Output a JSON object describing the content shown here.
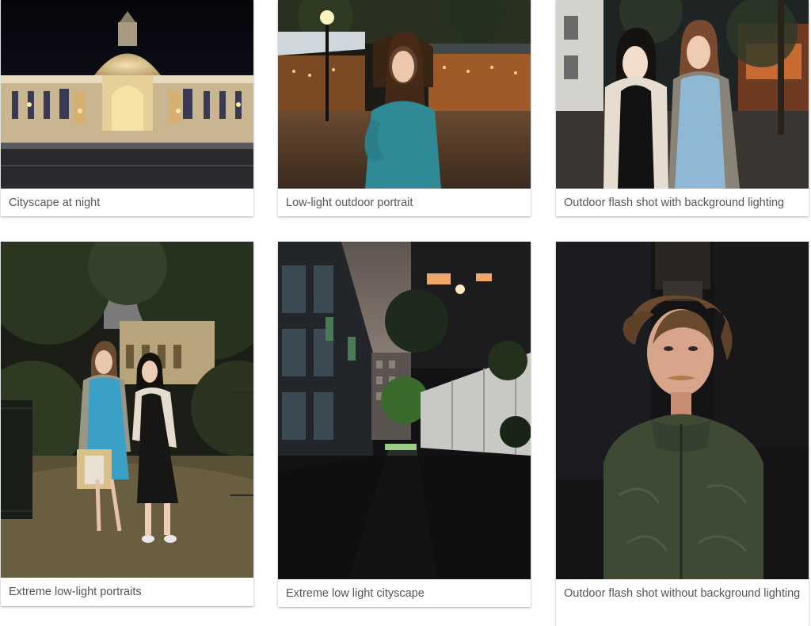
{
  "gallery": {
    "items": [
      {
        "caption": "Cityscape at night",
        "photo": "paris-palace-at-night-photo"
      },
      {
        "caption": "Low-light outdoor portrait",
        "photo": "woman-cafe-terrace-photo"
      },
      {
        "caption": "Outdoor flash shot with background lighting",
        "photo": "two-women-street-photo"
      },
      {
        "caption": "Extreme low-light portraits",
        "photo": "two-women-park-photo"
      },
      {
        "caption": "Extreme low light cityscape",
        "photo": "dark-alley-buildings-photo"
      },
      {
        "caption": "Outdoor flash shot without background lighting",
        "photo": "man-green-jacket-photo"
      }
    ]
  },
  "colors": {
    "caption_text": "#555555",
    "card_background": "#ffffff"
  }
}
